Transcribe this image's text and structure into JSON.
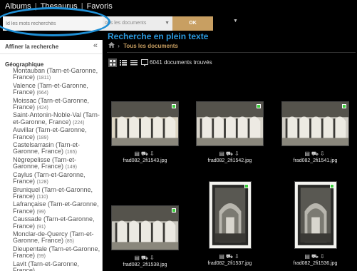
{
  "nav": {
    "items": [
      "Albums",
      "Thesaurus",
      "Favoris"
    ],
    "separators": [
      "|",
      "|"
    ]
  },
  "search": {
    "placeholder": "Id les mots recherchés",
    "scope": "ous les documents",
    "ok_label": "OK"
  },
  "page_title": "Recherche en plein texte",
  "sidebar": {
    "title": "Affiner la recherche",
    "collapse_glyph": "«",
    "section_title": "Géographique",
    "facets": [
      {
        "label": "Montauban (Tarn-et-Garonne, France)",
        "count": "(1811)"
      },
      {
        "label": "Valence (Tarn-et-Garonne, France)",
        "count": "(664)"
      },
      {
        "label": "Moissac (Tarn-et-Garonne, France)",
        "count": "(424)"
      },
      {
        "label": "Saint-Antonin-Noble-Val (Tarn-et-Garonne, France)",
        "count": "(224)"
      },
      {
        "label": "Auvillar (Tarn-et-Garonne, France)",
        "count": "(189)"
      },
      {
        "label": "Castelsarrasin (Tarn-et-Garonne, France)",
        "count": "(165)"
      },
      {
        "label": "Nègrepelisse (Tarn-et-Garonne, France)",
        "count": "(149)"
      },
      {
        "label": "Caylus (Tarn-et-Garonne, France)",
        "count": "(128)"
      },
      {
        "label": "Bruniquel (Tarn-et-Garonne, France)",
        "count": "(110)"
      },
      {
        "label": "Lafrançaise (Tarn-et-Garonne, France)",
        "count": "(99)"
      },
      {
        "label": "Caussade (Tarn-et-Garonne, France)",
        "count": "(91)"
      },
      {
        "label": "Monclar-de-Quercy (Tarn-et-Garonne, France)",
        "count": "(85)"
      },
      {
        "label": "Dieupentale (Tarn-et-Garonne, France)",
        "count": "(59)"
      },
      {
        "label": "Lavit (Tarn-et-Garonne, France)",
        "count": ""
      }
    ]
  },
  "breadcrumb": {
    "home_icon": "home-icon",
    "current": "Tous les documents"
  },
  "results": {
    "count_text": "6041 documents trouvés",
    "view_icons": [
      "grid-view-icon",
      "list-view-icon",
      "detail-view-icon",
      "slideshow-icon"
    ],
    "items": [
      {
        "filename": "frad082_2fi1543.jpg",
        "thumb": "landscape"
      },
      {
        "filename": "frad082_2fi1542.jpg",
        "thumb": "landscape"
      },
      {
        "filename": "frad082_2fi1541.jpg",
        "thumb": "landscape"
      },
      {
        "filename": "frad082_2fi1538.jpg",
        "thumb": "landscape"
      },
      {
        "filename": "frad082_2fi1537.jpg",
        "thumb": "portrait"
      },
      {
        "filename": "frad082_2fi1536.jpg",
        "thumb": "portrait"
      }
    ],
    "action_icons": [
      "details-icon",
      "cart-icon",
      "download-icon"
    ],
    "selected_color": "#3ccf3c"
  },
  "colors": {
    "accent": "#c89f62",
    "title_blue": "#2a9adf",
    "highlight_ellipse": "#1e8fd6"
  }
}
